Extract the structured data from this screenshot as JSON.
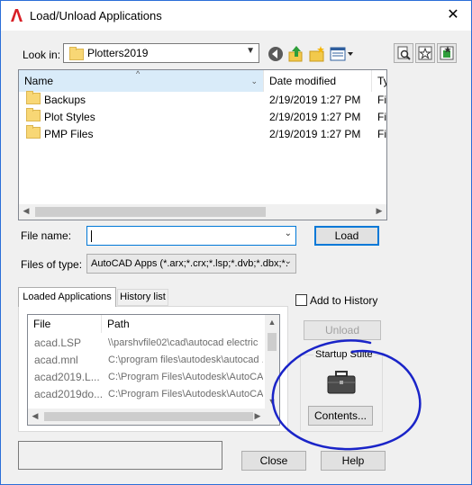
{
  "window": {
    "title": "Load/Unload Applications",
    "close_glyph": "✕"
  },
  "look_in": {
    "label": "Look in:",
    "value": "Plotters2019"
  },
  "file_list": {
    "columns": [
      "Name",
      "Date modified",
      "Ty"
    ],
    "rows": [
      {
        "name": "Backups",
        "date": "2/19/2019 1:27 PM",
        "type": "Fi"
      },
      {
        "name": "Plot Styles",
        "date": "2/19/2019 1:27 PM",
        "type": "Fi"
      },
      {
        "name": "PMP Files",
        "date": "2/19/2019 1:27 PM",
        "type": "Fi"
      }
    ]
  },
  "file_name": {
    "label": "File name:",
    "value": ""
  },
  "files_of_type": {
    "label": "Files of type:",
    "value": "AutoCAD Apps (*.arx;*.crx;*.lsp;*.dvb;*.dbx;*."
  },
  "load_button": "Load",
  "tabs": {
    "loaded": "Loaded Applications",
    "history": "History list"
  },
  "loaded_apps": {
    "columns": [
      "File",
      "Path"
    ],
    "rows": [
      {
        "file": "acad.LSP",
        "path": "\\\\parshvfile02\\cad\\autocad electric"
      },
      {
        "file": "acad.mnl",
        "path": "C:\\program files\\autodesk\\autocad ."
      },
      {
        "file": "acad2019.L...",
        "path": "C:\\Program Files\\Autodesk\\AutoCA"
      },
      {
        "file": "acad2019do...",
        "path": "C:\\Program Files\\Autodesk\\AutoCA"
      }
    ]
  },
  "add_to_history": "Add to History",
  "unload_button": "Unload",
  "startup_suite": {
    "label": "Startup Suite",
    "contents_button": "Contents..."
  },
  "close_button": "Close",
  "help_button": "Help",
  "colors": {
    "accent": "#0078d7",
    "annotation": "#1a24c8",
    "folder": "#f8d775"
  },
  "icons": [
    "back-icon",
    "up-folder-icon",
    "new-folder-icon",
    "views-menu-icon",
    "find-file-icon",
    "add-favorites-icon",
    "favorites-icon",
    "briefcase-icon"
  ]
}
